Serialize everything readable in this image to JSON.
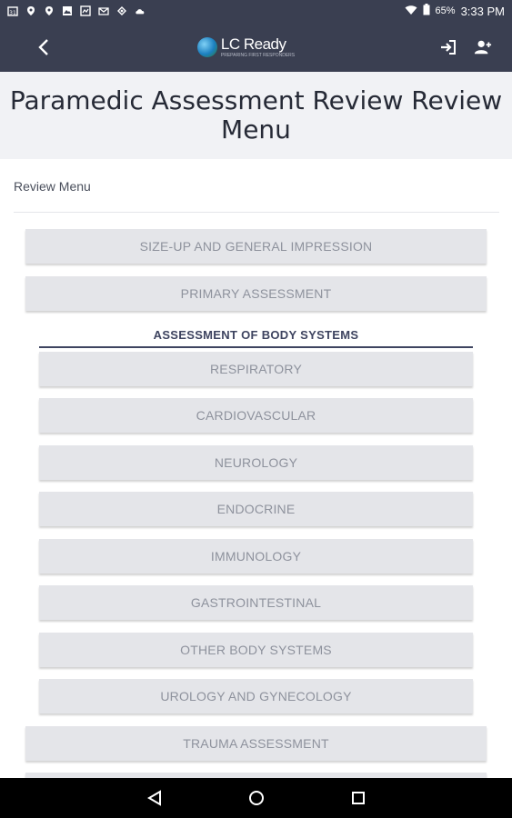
{
  "status_bar": {
    "battery": "65%",
    "time": "3:33 PM",
    "left_icons": [
      "calendar-icon",
      "location-icon",
      "location-icon",
      "image-icon",
      "gallery-icon",
      "inbox-icon",
      "sync-icon",
      "cloud-icon"
    ]
  },
  "app_bar": {
    "logo_name": "LC Ready",
    "logo_tagline": "PREPARING FIRST RESPONDERS"
  },
  "page": {
    "title": "Paramedic Assessment Review Review Menu",
    "breadcrumb": "Review Menu"
  },
  "menu": {
    "top_items": [
      "SIZE-UP AND GENERAL IMPRESSION",
      "PRIMARY ASSESSMENT"
    ],
    "section_heading": "ASSESSMENT OF BODY SYSTEMS",
    "system_items": [
      "RESPIRATORY",
      "CARDIOVASCULAR",
      "NEUROLOGY",
      "ENDOCRINE",
      "IMMUNOLOGY",
      "GASTROINTESTINAL",
      "OTHER BODY SYSTEMS",
      "UROLOGY AND GYNECOLOGY"
    ],
    "bottom_items": [
      "TRAUMA ASSESSMENT"
    ]
  },
  "colors": {
    "header_bg": "#3a3f51",
    "title_bg": "#f1f2f5",
    "button_bg": "#e4e5e9",
    "button_text": "#8e929d",
    "section_accent": "#3e4460"
  }
}
